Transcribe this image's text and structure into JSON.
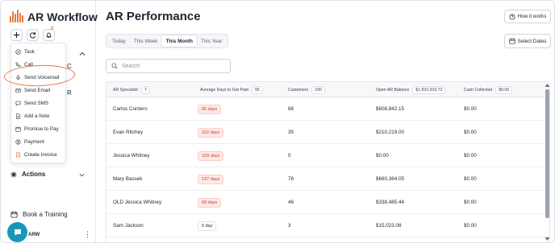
{
  "app": {
    "title": "AR Workflow",
    "notification_count": "2"
  },
  "sidebar": {
    "partial_c": "C",
    "partial_r": "R",
    "actions_label": "Actions",
    "book_training_label": "Book a Training",
    "user_name": "ARW"
  },
  "menu": {
    "items": [
      {
        "label": "Task",
        "icon": "check-circle-icon"
      },
      {
        "label": "Call",
        "icon": "phone-icon"
      },
      {
        "label": "Send Voicemail",
        "icon": "microphone-icon"
      },
      {
        "label": "Send Email",
        "icon": "mail-icon"
      },
      {
        "label": "Send SMS",
        "icon": "chat-icon"
      },
      {
        "label": "Add a Note",
        "icon": "note-icon"
      },
      {
        "label": "Promise to Pay",
        "icon": "calendar-icon"
      },
      {
        "label": "Payment",
        "icon": "dollar-icon"
      },
      {
        "label": "Create Invoice",
        "icon": "invoice-icon"
      }
    ]
  },
  "main": {
    "title": "AR Performance",
    "how_it_works": "How it works",
    "select_dates": "Select Dates",
    "tabs": [
      {
        "label": "Today",
        "active": false
      },
      {
        "label": "This Week",
        "active": false
      },
      {
        "label": "This Month",
        "active": true
      },
      {
        "label": "This Year",
        "active": false
      }
    ],
    "search_placeholder": "Search"
  },
  "table": {
    "headers": {
      "specialist": {
        "label": "AR Specialist",
        "count": "7"
      },
      "avg_days": {
        "label": "Average Days to Get Paid",
        "count": "95"
      },
      "customers": {
        "label": "Customers",
        "count": "230"
      },
      "balance": {
        "label": "Open AR Balance",
        "count": "$1,832,933.72"
      },
      "cash": {
        "label": "Cash Collected",
        "count": "$0.00"
      }
    },
    "rows": [
      {
        "name": "Carlos Cordero",
        "days": "95 days",
        "days_status": "red",
        "customers": "68",
        "balance": "$608,842.15",
        "cash": "$0.00"
      },
      {
        "name": "Evan Ritchey",
        "days": "152 days",
        "days_status": "red",
        "customers": "35",
        "balance": "$210,219.00",
        "cash": "$0.00"
      },
      {
        "name": "Jessica Whitney",
        "days": "109 days",
        "days_status": "red",
        "customers": "0",
        "balance": "$0.00",
        "cash": "$0.00"
      },
      {
        "name": "Mary Bassek",
        "days": "137 days",
        "days_status": "red",
        "customers": "78",
        "balance": "$660,364.05",
        "cash": "$0.00"
      },
      {
        "name": "OLD Jessica Whitney",
        "days": "68 days",
        "days_status": "red",
        "customers": "46",
        "balance": "$338,485.44",
        "cash": "$0.00"
      },
      {
        "name": "Sam Jackson",
        "days": "0 day",
        "days_status": "neutral",
        "customers": "3",
        "balance": "$15,023.08",
        "cash": "$0.00"
      }
    ]
  },
  "colors": {
    "accent": "#e5783a",
    "danger": "#c8402c",
    "chat": "#1796b8"
  }
}
